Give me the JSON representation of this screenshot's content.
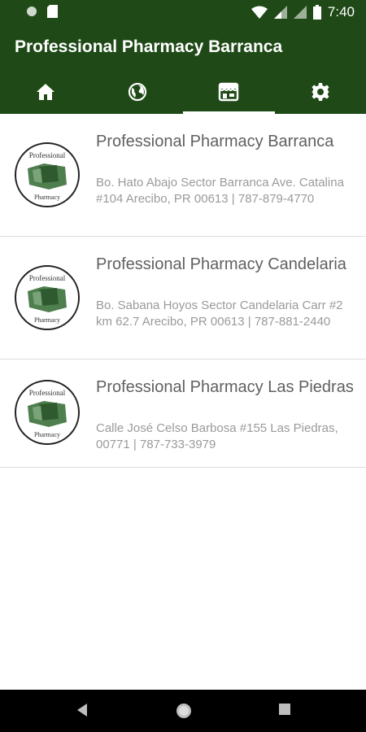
{
  "status_bar": {
    "time": "7:40",
    "icons": [
      "circle-notification-icon",
      "sd-card-icon",
      "wifi-icon",
      "signal-icon",
      "battery-icon"
    ]
  },
  "app_bar": {
    "title": "Professional Pharmacy Barranca",
    "background_color": "#1f4a17"
  },
  "tabs": [
    {
      "icon": "home-icon",
      "active": false
    },
    {
      "icon": "globe-icon",
      "active": false
    },
    {
      "icon": "store-icon",
      "active": true
    },
    {
      "icon": "settings-icon",
      "active": false
    }
  ],
  "locations": [
    {
      "name": "Professional Pharmacy Barranca",
      "address": "Bo. Hato Abajo Sector Barranca Ave. Catalina #104 Arecibo, PR 00613 | 787-879-4770"
    },
    {
      "name": "Professional Pharmacy Candelaria",
      "address": "Bo. Sabana Hoyos Sector Candelaria Carr #2 km 62.7 Arecibo, PR 00613 | 787-881-2440"
    },
    {
      "name": "Professional Pharmacy Las Piedras",
      "address": "Calle José Celso Barbosa #155 Las Piedras,  00771 | 787-733-3979"
    }
  ],
  "logo": {
    "top_text": "Professional",
    "bottom_text": "Pharmacy"
  },
  "nav_bar": {
    "icons": [
      "back-icon",
      "home-circle-icon",
      "recents-icon"
    ]
  }
}
